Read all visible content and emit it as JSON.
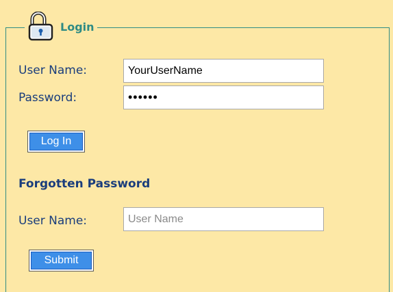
{
  "login": {
    "legend": "Login",
    "icon": "padlock-icon",
    "username_label": "User Name:",
    "username_value": "YourUserName",
    "password_label": "Password:",
    "password_value": "••••••",
    "login_button": "Log In"
  },
  "forgotten": {
    "heading": "Forgotten Password",
    "username_label": "User Name:",
    "username_placeholder": "User Name",
    "submit_button": "Submit"
  },
  "colors": {
    "background": "#fde8a6",
    "border": "#2e8b84",
    "label_text": "#1a3d7c",
    "button": "#3e8fe8"
  }
}
